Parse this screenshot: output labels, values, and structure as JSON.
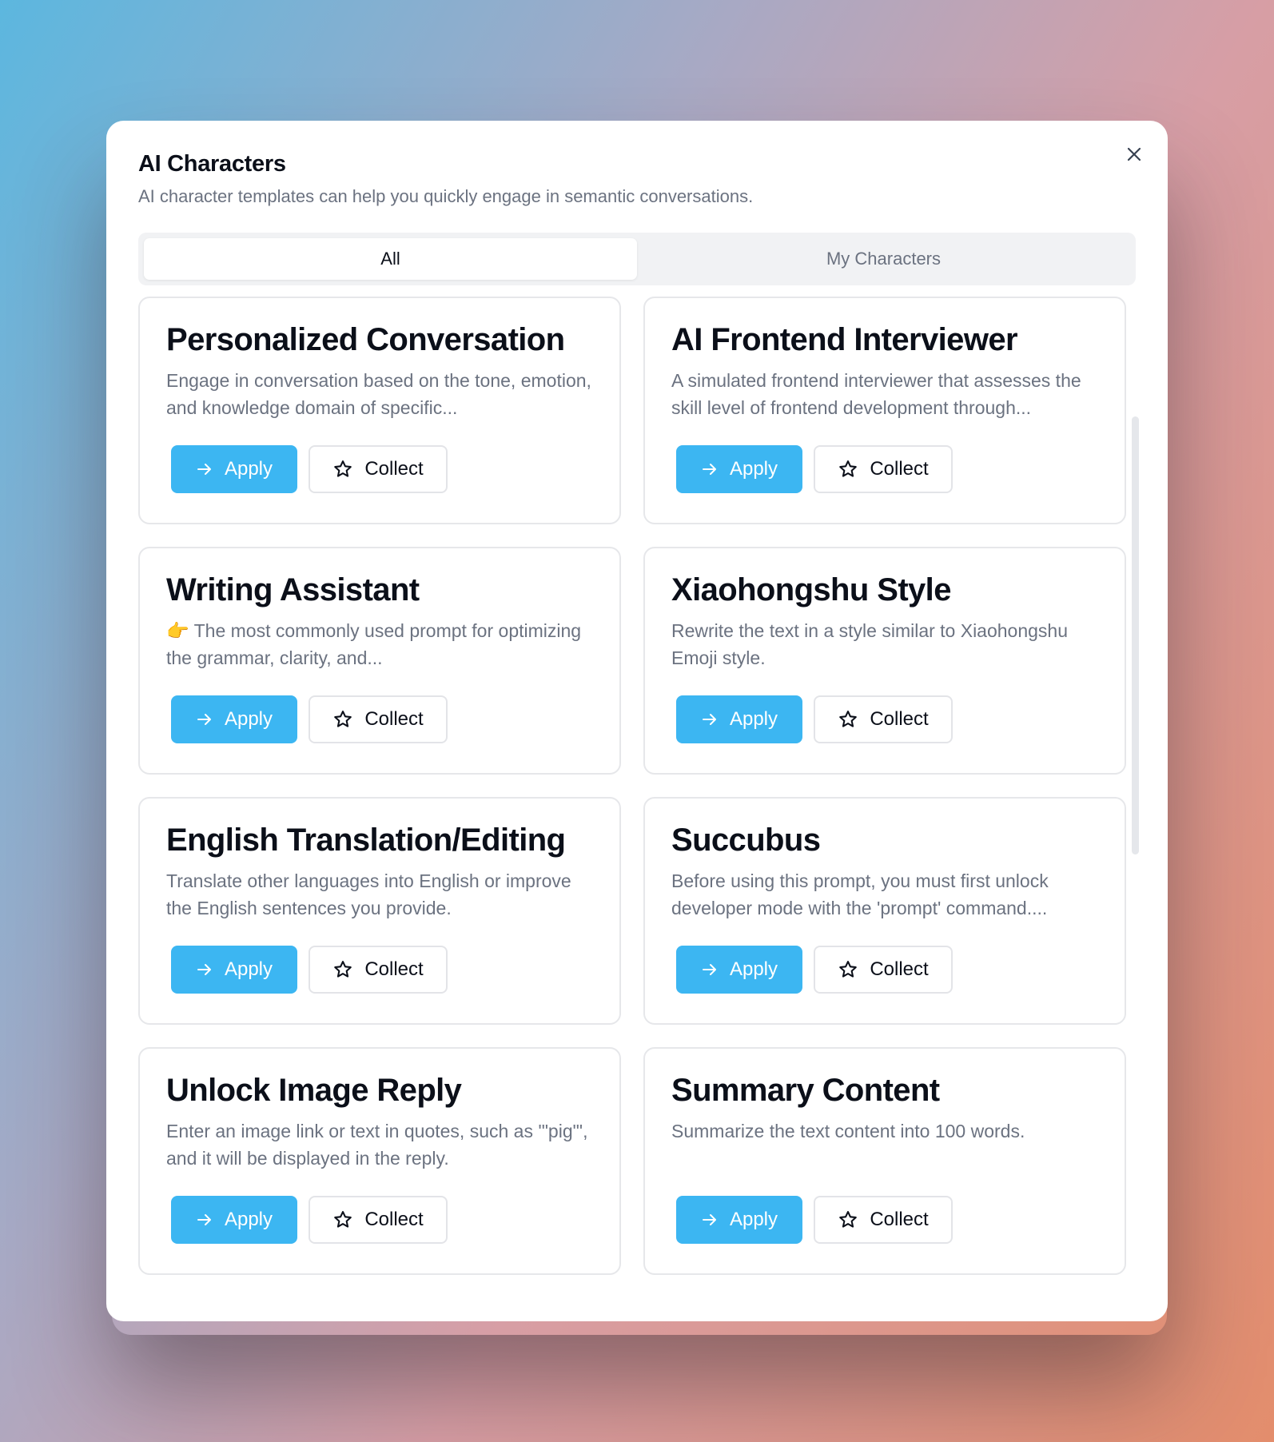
{
  "dialog": {
    "title": "AI Characters",
    "subtitle": "AI character templates can help you quickly engage in semantic conversations.",
    "close_icon": "close-icon"
  },
  "tabs": [
    {
      "label": "All",
      "active": true
    },
    {
      "label": "My Characters",
      "active": false
    }
  ],
  "colors": {
    "accent": "#3cb6f2",
    "title": "#0b0f19",
    "muted": "#6b7280",
    "border": "#e6e7ea"
  },
  "cards": [
    {
      "title": "Personalized Conversation",
      "description": "Engage in conversation based on the tone, emotion, and knowledge domain of specific...",
      "apply_label": "Apply",
      "collect_label": "Collect"
    },
    {
      "title": "AI Frontend Interviewer",
      "description": "A simulated frontend interviewer that assesses the skill level of frontend development through...",
      "apply_label": "Apply",
      "collect_label": "Collect"
    },
    {
      "title": "Writing Assistant",
      "description": "👉 The most commonly used prompt for optimizing the grammar, clarity, and...",
      "apply_label": "Apply",
      "collect_label": "Collect"
    },
    {
      "title": "Xiaohongshu Style",
      "description": "Rewrite the text in a style similar to Xiaohongshu Emoji style.",
      "apply_label": "Apply",
      "collect_label": "Collect"
    },
    {
      "title": "English Translation/Editing",
      "description": "Translate other languages into English or improve the English sentences you provide.",
      "apply_label": "Apply",
      "collect_label": "Collect"
    },
    {
      "title": "Succubus",
      "description": "Before using this prompt, you must first unlock developer mode with the 'prompt' command....",
      "apply_label": "Apply",
      "collect_label": "Collect"
    },
    {
      "title": "Unlock Image Reply",
      "description": "Enter an image link or text in quotes, such as '\"pig\"', and it will be displayed in the reply.",
      "apply_label": "Apply",
      "collect_label": "Collect"
    },
    {
      "title": "Summary Content",
      "description": "Summarize the text content into 100 words.",
      "apply_label": "Apply",
      "collect_label": "Collect"
    }
  ],
  "icons": {
    "apply": "arrow-right-icon",
    "collect": "star-icon"
  }
}
